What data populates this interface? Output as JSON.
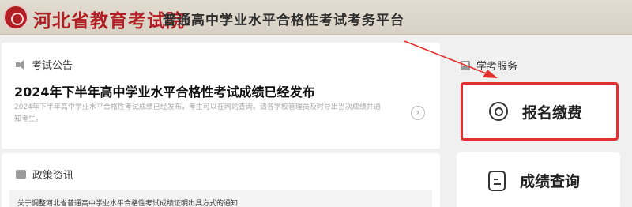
{
  "header": {
    "org_name": "河北省教育考试院",
    "platform_name": "普通高中学业水平合格性考试考务平台"
  },
  "announcement": {
    "section_title": "考试公告",
    "news_title": "2024年下半年高中学业水平合格性考试成绩已经发布",
    "news_desc": "2024年下半年高中学业水平合格性考试成绩已经发布，考生可以在网站查询。请各学校管理员及时导出当次成绩并通知考生。",
    "next_glyph": "›"
  },
  "policy": {
    "section_title": "政策资讯",
    "items": [
      "关于调整河北省普通高中学业水平合格性考试成绩证明出具方式的通知"
    ]
  },
  "services": {
    "section_title": "学考服务",
    "register_label": "报名缴费",
    "score_label": "成绩查询"
  },
  "colors": {
    "brand_red": "#b21e23",
    "highlight_red": "#e0312e"
  }
}
